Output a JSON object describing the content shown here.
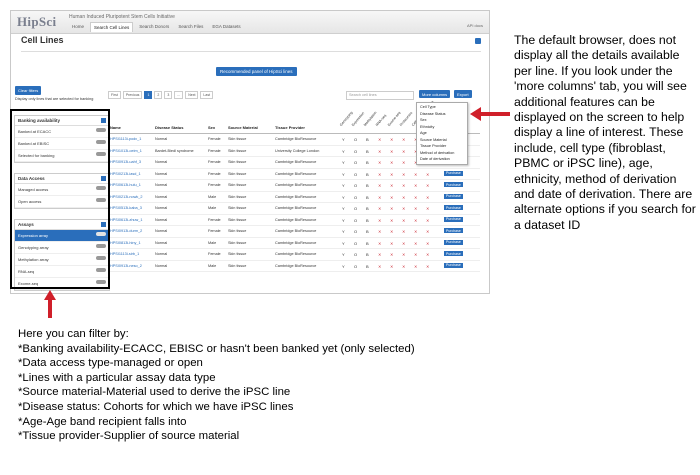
{
  "app": {
    "logo": "HipSci",
    "tagline": "Human Induced Pluripotent Stem Cells Initiative",
    "nav": [
      "Home",
      "Search Cell Lines",
      "Search Donors",
      "Search Files",
      "EGA Datasets"
    ],
    "api_view": "API docs",
    "page_title": "Cell Lines"
  },
  "toolbar": {
    "recommended_label": "Recommended panel of HipSci lines",
    "clear_filters_label": "Clear filters",
    "only_banking_label": "Display only lines that are selected for banking",
    "pager": [
      "First",
      "Previous",
      "1",
      "2",
      "3",
      "...",
      "Next",
      "Last"
    ],
    "search_placeholder": "Search cell lines",
    "more_columns_label": "More columns",
    "export_label": "Export"
  },
  "filters": [
    {
      "title": "Banking availability",
      "items": [
        {
          "label": "Banked at ECACC",
          "selected": false
        },
        {
          "label": "Banked at EBISC",
          "selected": false
        },
        {
          "label": "Selected for banking",
          "selected": false
        }
      ]
    },
    {
      "title": "Data Access",
      "items": [
        {
          "label": "Managed access",
          "selected": false
        },
        {
          "label": "Open access",
          "selected": false
        }
      ]
    },
    {
      "title": "Assays",
      "items": [
        {
          "label": "Expression array",
          "selected": true
        },
        {
          "label": "Genotyping array",
          "selected": false
        },
        {
          "label": "Methylation array",
          "selected": false
        },
        {
          "label": "RNA-seq",
          "selected": false
        },
        {
          "label": "Exome-seq",
          "selected": false
        }
      ]
    }
  ],
  "table": {
    "headers": [
      "Name",
      "Disease Status",
      "Sex",
      "Source Material",
      "Tissue Provider"
    ],
    "assay_headers": [
      "Genotyping",
      "Expression",
      "Methylation",
      "RNA-seq",
      "Exome-seq",
      "Proteomics",
      "Cellular phenotyping",
      "Banked"
    ],
    "rows": [
      {
        "name": "HPSI1113i-podx_1",
        "disease": "Normal",
        "sex": "Female",
        "source": "Skin tissue",
        "provider": "Cambridge BioResource"
      },
      {
        "name": "HPSI1013i-oeim_1",
        "disease": "Bardet-Biedl syndrome",
        "sex": "Female",
        "source": "Skin tissue",
        "provider": "University College London"
      },
      {
        "name": "HPSI0913i-uahf_3",
        "disease": "Normal",
        "sex": "Female",
        "source": "Skin tissue",
        "provider": "Cambridge BioResource"
      },
      {
        "name": "HPSI0213i-iasd_1",
        "disease": "Normal",
        "sex": "Female",
        "source": "Skin tissue",
        "provider": "Cambridge BioResource"
      },
      {
        "name": "HPSI0613i-hulu_1",
        "disease": "Normal",
        "sex": "Female",
        "source": "Skin tissue",
        "provider": "Cambridge BioResource"
      },
      {
        "name": "HPSI0213i-nowk_2",
        "disease": "Normal",
        "sex": "Male",
        "source": "Skin tissue",
        "provider": "Cambridge BioResource"
      },
      {
        "name": "HPSI0513i-kaba_3",
        "disease": "Normal",
        "sex": "Male",
        "source": "Skin tissue",
        "provider": "Cambridge BioResource"
      },
      {
        "name": "HPSI0613i-zhuw_1",
        "disease": "Normal",
        "sex": "Female",
        "source": "Skin tissue",
        "provider": "Cambridge BioResource"
      },
      {
        "name": "HPSI0913i-durm_2",
        "disease": "Normal",
        "sex": "Female",
        "source": "Skin tissue",
        "provider": "Cambridge BioResource"
      },
      {
        "name": "HPSI0813i-hiny_1",
        "disease": "Normal",
        "sex": "Male",
        "source": "Skin tissue",
        "provider": "Cambridge BioResource"
      },
      {
        "name": "HPSI1113i-sirb_1",
        "disease": "Normal",
        "sex": "Female",
        "source": "Skin tissue",
        "provider": "Cambridge BioResource"
      },
      {
        "name": "HPSI0913i-neso_2",
        "disease": "Normal",
        "sex": "Male",
        "source": "Skin tissue",
        "provider": "Cambridge BioResource"
      }
    ],
    "purchase_label": "Purchase"
  },
  "more_columns_menu": [
    "Cell Type",
    "Disease Status",
    "Sex",
    "Ethnicity",
    "Age",
    "Source Material",
    "Tissue Provider",
    "Method of derivation",
    "Date of derivation"
  ],
  "annotations": {
    "side_note": "The default browser, does not display all the details available per line. If you look under the 'more columns' tab, you will see additional features can be displayed on the screen to help display a line of interest. These include, cell type (fibroblast, PBMC or iPSC line), age, ethnicity, method of derivation and date of derivation. There are alternate options if you search for a dataset ID",
    "bottom_lines": [
      "Here you can filter by:",
      "*Banking availability-ECACC, EBISC or hasn't been banked yet (only selected)",
      "*Data access type-managed or open",
      "*Lines with a particular assay data type",
      "*Source material-Material used to derive the iPSC line",
      "*Disease status: Cohorts for which we have iPSC lines",
      "*Age-Age band recipient falls into",
      "*Tissue provider-Supplier of source material"
    ]
  },
  "colors": {
    "accent": "#2a6ebb",
    "arrow": "#d01f2a"
  }
}
